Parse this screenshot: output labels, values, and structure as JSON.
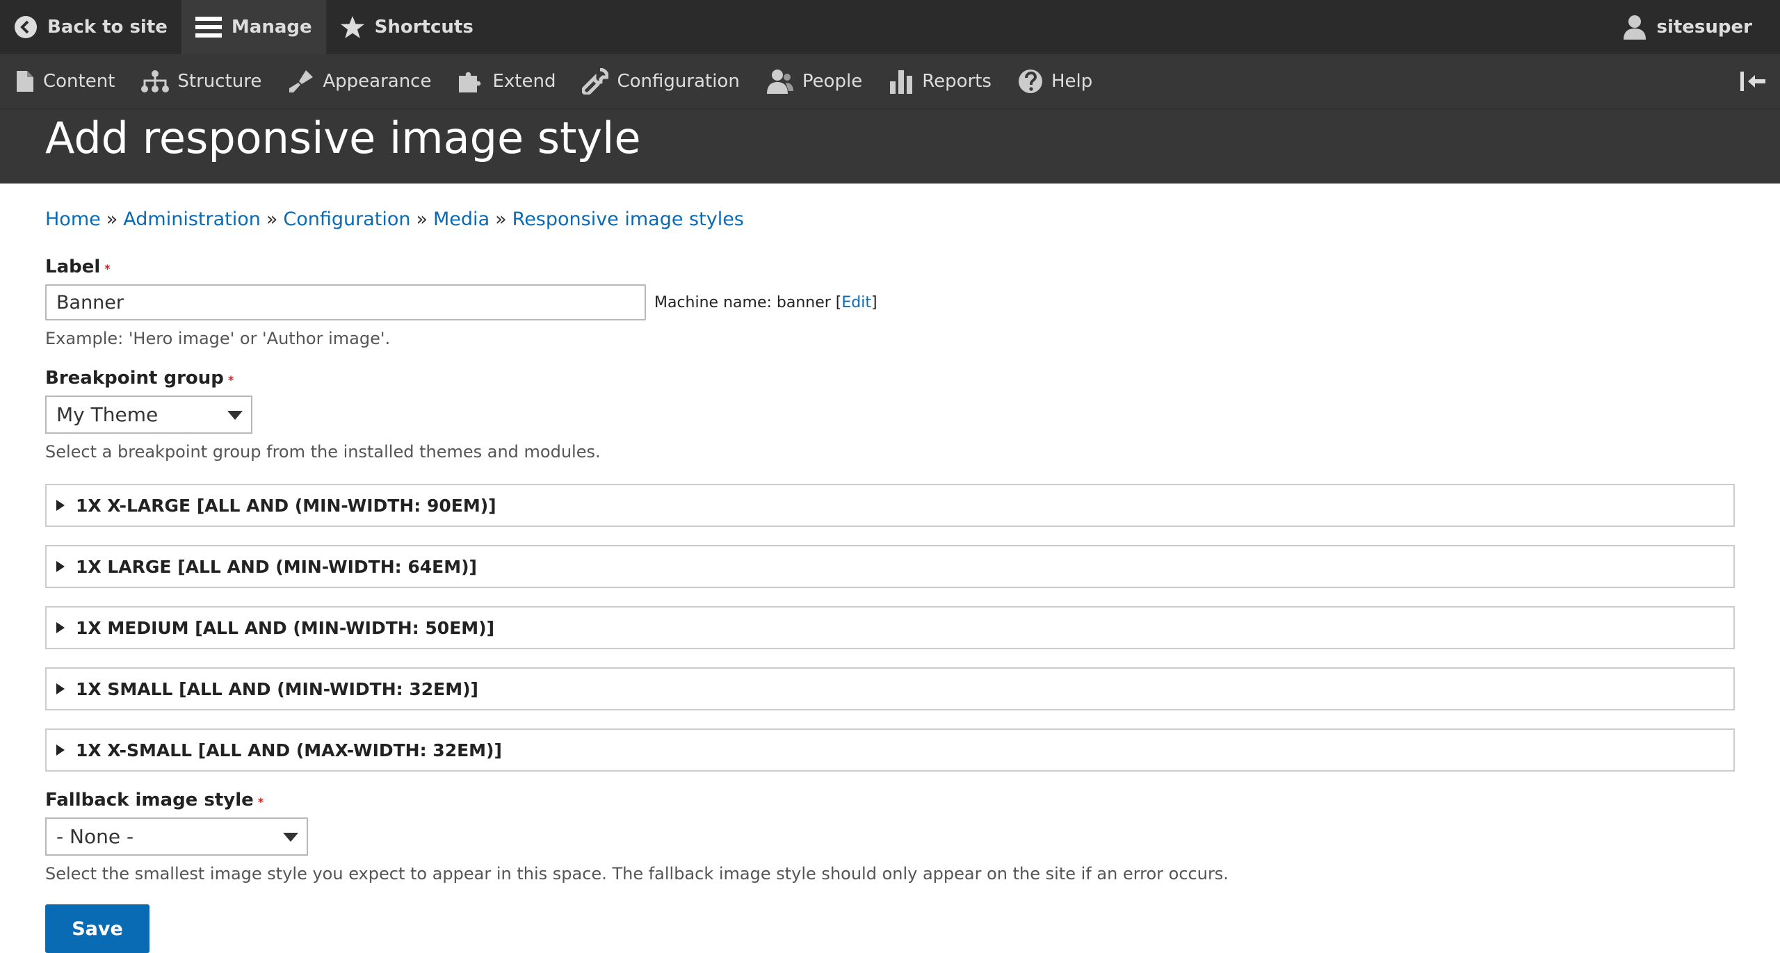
{
  "toolbar": {
    "back_to_site": "Back to site",
    "manage": "Manage",
    "shortcuts": "Shortcuts",
    "user": "sitesuper"
  },
  "tray": {
    "items": [
      {
        "label": "Content",
        "icon": "file-icon"
      },
      {
        "label": "Structure",
        "icon": "sitemap-icon"
      },
      {
        "label": "Appearance",
        "icon": "paintbrush-icon"
      },
      {
        "label": "Extend",
        "icon": "puzzle-icon"
      },
      {
        "label": "Configuration",
        "icon": "wrench-icon"
      },
      {
        "label": "People",
        "icon": "people-icon"
      },
      {
        "label": "Reports",
        "icon": "bar-chart-icon"
      },
      {
        "label": "Help",
        "icon": "help-icon"
      }
    ]
  },
  "page": {
    "title": "Add responsive image style"
  },
  "breadcrumb": {
    "items": [
      "Home",
      "Administration",
      "Configuration",
      "Media",
      "Responsive image styles"
    ],
    "separator": "»"
  },
  "form": {
    "label": {
      "title": "Label",
      "required_mark": "*",
      "value": "Banner",
      "machine_name_prefix": "Machine name: banner [",
      "machine_name_edit": "Edit",
      "machine_name_suffix": "]",
      "description": "Example: 'Hero image' or 'Author image'."
    },
    "breakpoint_group": {
      "title": "Breakpoint group",
      "required_mark": "*",
      "value": "My Theme",
      "description": "Select a breakpoint group from the installed themes and modules."
    },
    "breakpoints": [
      "1X X-LARGE [ALL AND (MIN-WIDTH: 90EM)]",
      "1X LARGE [ALL AND (MIN-WIDTH: 64EM)]",
      "1X MEDIUM [ALL AND (MIN-WIDTH: 50EM)]",
      "1X SMALL [ALL AND (MIN-WIDTH: 32EM)]",
      "1X X-SMALL [ALL AND (MAX-WIDTH: 32EM)]"
    ],
    "fallback": {
      "title": "Fallback image style",
      "required_mark": "*",
      "value": "- None -",
      "description": "Select the smallest image style you expect to appear in this space. The fallback image style should only appear on the site if an error occurs."
    },
    "save_label": "Save"
  },
  "colors": {
    "toolbar_bg": "#2b2b2b",
    "tray_bg": "#373737",
    "link": "#0a6bb5",
    "button": "#0a6bb5",
    "required": "#cc2222"
  }
}
